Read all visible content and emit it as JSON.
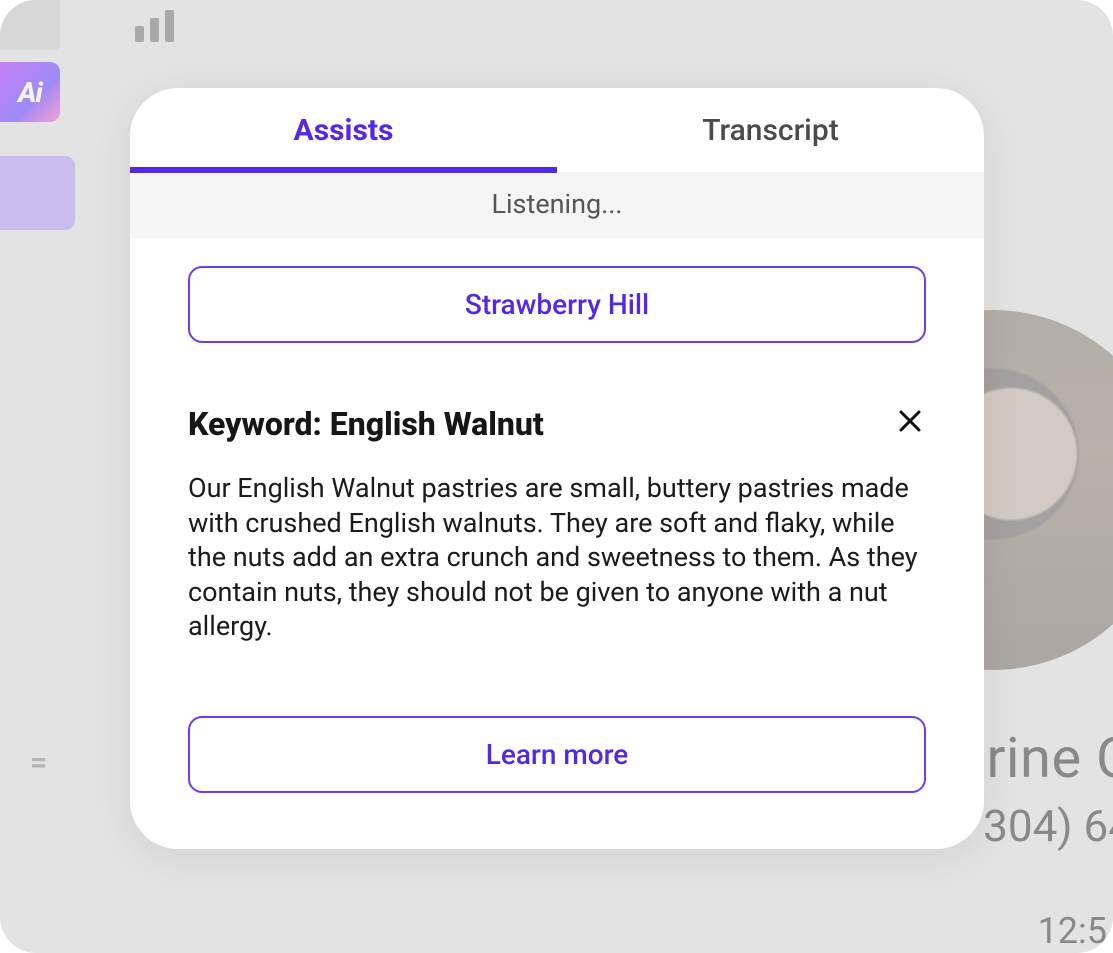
{
  "sidebar": {
    "ai_badge_text": "Ai"
  },
  "background": {
    "name_fragment": "rine C",
    "phone_fragment": "304) 64",
    "time_fragment": "12:5"
  },
  "modal": {
    "tabs": {
      "assists": "Assists",
      "transcript": "Transcript"
    },
    "status": "Listening...",
    "chip_label": "Strawberry Hill",
    "card": {
      "title": "Keyword: English Walnut",
      "body": "Our English Walnut pastries are small, buttery pastries made with crushed English walnuts. They are soft and flaky, while the nuts add an extra crunch and sweetness to them. As they contain nuts, they should not be given to anyone with a nut allergy.",
      "learn_more": "Learn more"
    }
  }
}
